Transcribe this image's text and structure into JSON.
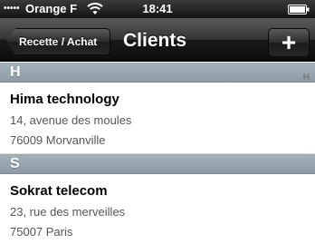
{
  "status_bar": {
    "signal": "•••••",
    "carrier": "Orange F",
    "time": "18:41"
  },
  "nav": {
    "back_label": "Recette / Achat",
    "title": "Clients",
    "add_label": "+"
  },
  "index": [
    "H"
  ],
  "sections": [
    {
      "header": "H",
      "rows": [
        {
          "name": "Hima technology",
          "street": "14, avenue des moules",
          "city": "76009 Morvanville"
        }
      ]
    },
    {
      "header": "S",
      "rows": [
        {
          "name": "Sokrat telecom",
          "street": "23, rue des merveilles",
          "city": "75007 Paris"
        }
      ]
    }
  ],
  "colors": {
    "section_header": "#95a2ad",
    "nav_bar": "#1a1a1a"
  }
}
